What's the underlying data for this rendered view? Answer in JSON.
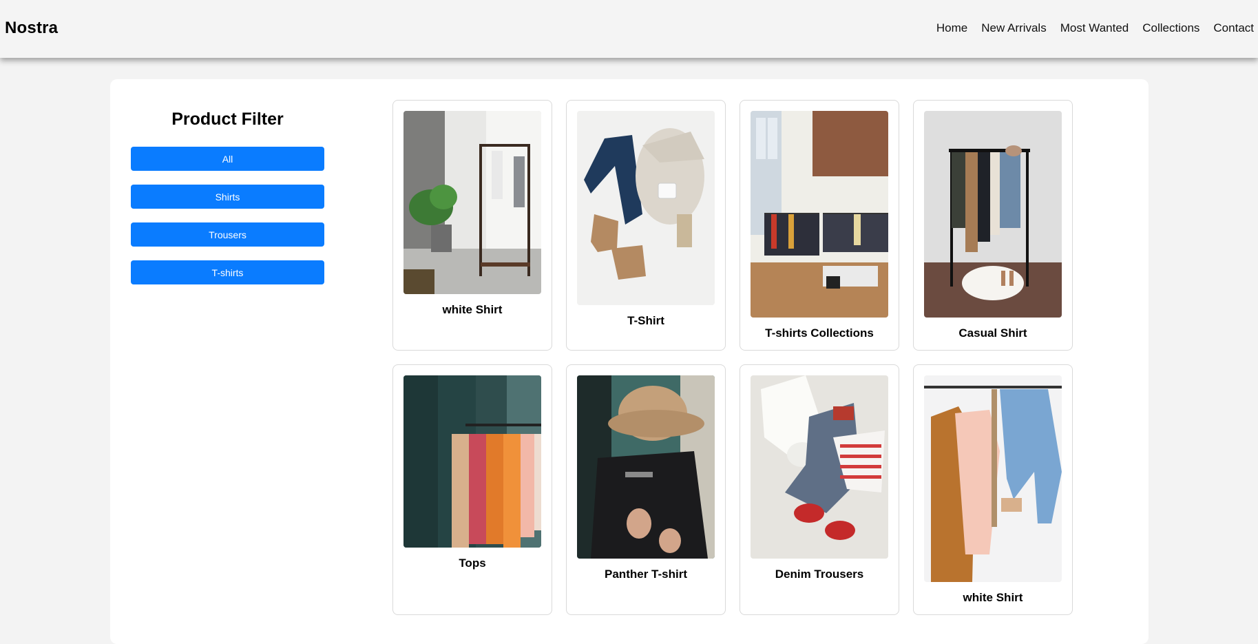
{
  "header": {
    "brand": "Nostra",
    "nav": [
      "Home",
      "New Arrivals",
      "Most Wanted",
      "Collections",
      "Contact"
    ]
  },
  "sidebar": {
    "title": "Product Filter",
    "filters": [
      "All",
      "Shirts",
      "Trousers",
      "T-shirts"
    ]
  },
  "products": [
    {
      "title": "white Shirt",
      "image": "clothes-rack-with-plant"
    },
    {
      "title": "T-Shirt",
      "image": "flatlay-jeans-sweater-boots"
    },
    {
      "title": "T-shirts Collections",
      "image": "store-interior-racks"
    },
    {
      "title": "Casual Shirt",
      "image": "coat-rack-with-fur-rug"
    },
    {
      "title": "Tops",
      "image": "colorful-tops-on-rack"
    },
    {
      "title": "Panther T-shirt",
      "image": "man-in-bucket-hat"
    },
    {
      "title": "Denim Trousers",
      "image": "flatlay-denim-sandals"
    },
    {
      "title": "white Shirt",
      "image": "jacket-shirt-jeans-hanging"
    }
  ],
  "colors": {
    "accent": "#0a7cff",
    "page_bg": "#f3f3f3",
    "panel_bg": "#ffffff"
  }
}
